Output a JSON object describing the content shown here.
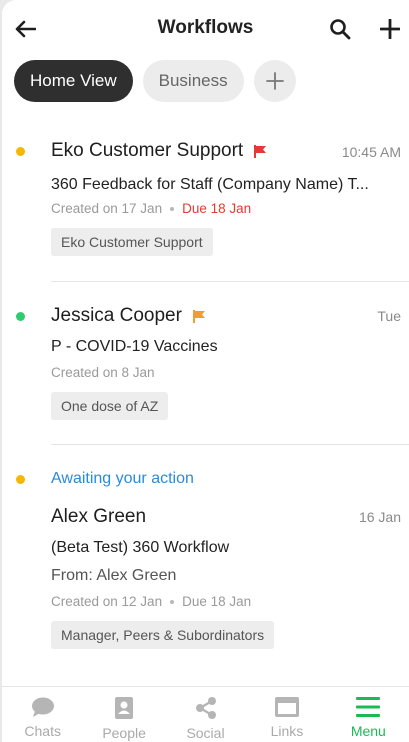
{
  "header": {
    "title": "Workflows"
  },
  "tabs": [
    {
      "label": "Home View"
    },
    {
      "label": "Business"
    }
  ],
  "items": [
    {
      "name": "Eko Customer Support",
      "time": "10:45 AM",
      "subject": "360 Feedback for Staff (Company Name) T...",
      "created": "Created on 17 Jan",
      "due": "Due 18 Jan",
      "tag": "Eko Customer Support",
      "dot_color": "#f5b700",
      "flag_color": "#e53935"
    },
    {
      "name": "Jessica Cooper",
      "time": "Tue",
      "subject": "P - COVID-19 Vaccines",
      "created": "Created on 8 Jan",
      "tag": "One dose of AZ",
      "dot_color": "#2ecc71",
      "flag_color": "#f39c34"
    },
    {
      "status": "Awaiting your action",
      "name": "Alex Green",
      "time": "16 Jan",
      "subject": "(Beta Test) 360 Workflow",
      "from": "From: Alex Green",
      "created": "Created on 12 Jan",
      "due": "Due 18 Jan",
      "tag": "Manager, Peers & Subordinators",
      "dot_color": "#f5b700"
    }
  ],
  "bottom_nav": [
    {
      "label": "Chats",
      "icon": "chat-icon"
    },
    {
      "label": "People",
      "icon": "contacts-icon"
    },
    {
      "label": "Social",
      "icon": "share-icon"
    },
    {
      "label": "Links",
      "icon": "browser-icon"
    },
    {
      "label": "Menu",
      "icon": "menu-icon",
      "active": true
    }
  ],
  "colors": {
    "accent": "#1db954",
    "link": "#2a8bd8",
    "due": "#e53935"
  }
}
